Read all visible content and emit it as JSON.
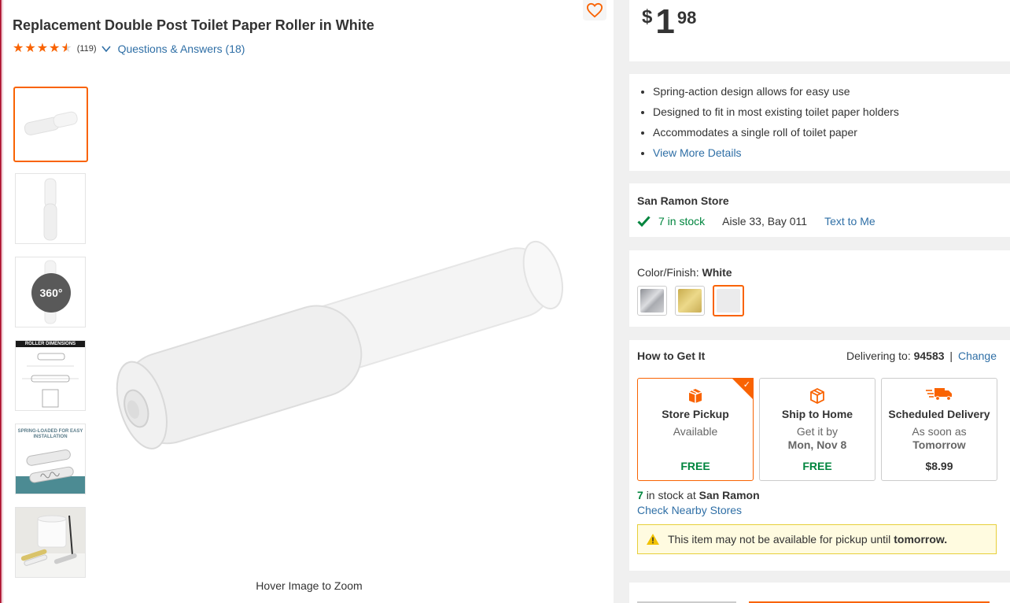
{
  "product": {
    "title": "Replacement Double Post Toilet Paper Roller in White",
    "review_count": "(119)",
    "qa_link": "Questions & Answers (18)",
    "rating": 4.5,
    "zoom_caption": "Hover Image to Zoom",
    "thumb_360_label": "360°",
    "thumb_dimensions_label": "ROLLER DIMENSIONS",
    "thumb_spring_label": "SPRING-LOADED FOR EASY INSTALLATION"
  },
  "price": {
    "currency": "$",
    "dollars": "1",
    "cents": "98"
  },
  "features": [
    "Spring-action design allows for easy use",
    "Designed to fit in most existing toilet paper holders",
    "Accommodates a single roll of toilet paper"
  ],
  "view_more": "View More Details",
  "store": {
    "name": "San Ramon Store",
    "stock": "7 in stock",
    "aisle": "Aisle 33, Bay 011",
    "text_me": "Text to Me"
  },
  "color": {
    "label": "Color/Finish:",
    "selected": "White",
    "swatches": [
      "#b8b9bd",
      "#d9c36a",
      "#ebebec"
    ]
  },
  "fulfillment": {
    "title": "How to Get It",
    "delivering_label": "Delivering to:",
    "zip": "94583",
    "separator": "|",
    "change": "Change",
    "options": [
      {
        "name": "Store Pickup",
        "sub": "Available",
        "sub2": "",
        "cost": "FREE",
        "icon": "store-pickup-icon"
      },
      {
        "name": "Ship to Home",
        "sub": "Get it by",
        "sub2": "Mon, Nov 8",
        "cost": "FREE",
        "icon": "ship-box-icon"
      },
      {
        "name": "Scheduled Delivery",
        "sub": "As soon as",
        "sub2": "Tomorrow",
        "cost": "$8.99",
        "icon": "delivery-truck-icon"
      }
    ],
    "instock_count": "7",
    "instock_mid": "in stock at",
    "instock_store": "San Ramon",
    "check_nearby": "Check Nearby Stores",
    "alert_text": "This item may not be available for pickup until",
    "alert_bold": "tomorrow."
  },
  "colors": {
    "accent": "#f96302",
    "green": "#00853e",
    "link": "#2f6fa6"
  }
}
